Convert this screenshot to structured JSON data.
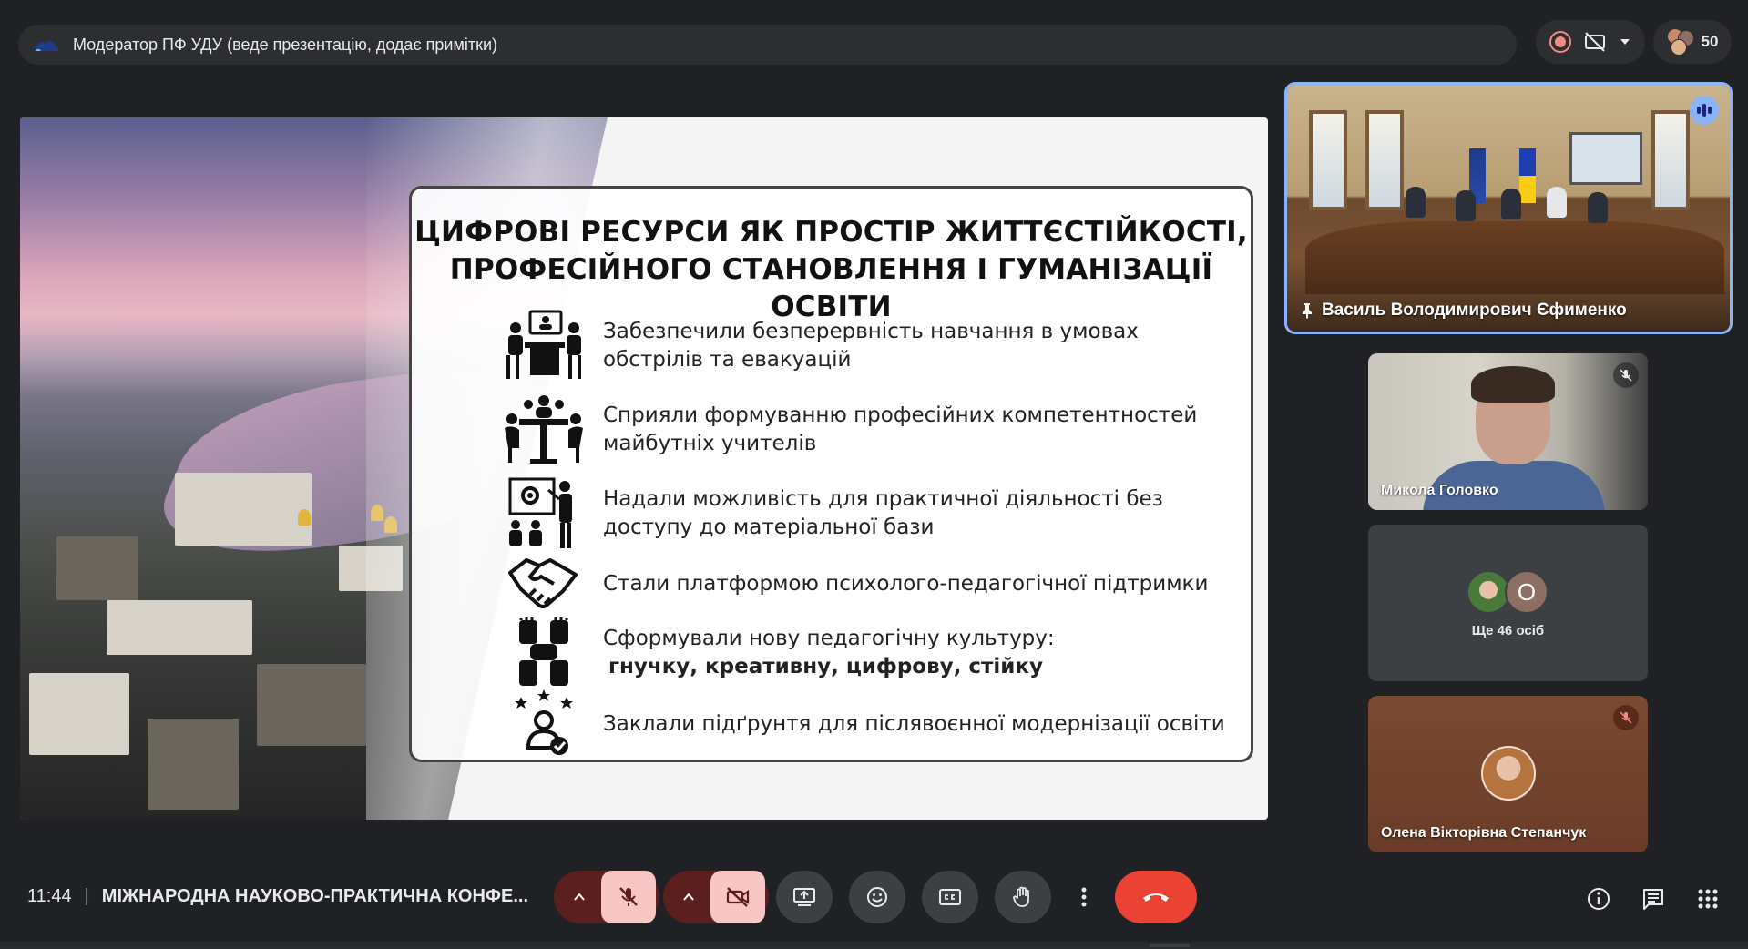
{
  "presenter_bar": {
    "text": "Модератор ПФ УДУ (веде презентацію, додає примітки)"
  },
  "participants": {
    "count": "50"
  },
  "slide": {
    "title_line1": "ЦИФРОВІ РЕСУРСИ ЯК ПРОСТІР ЖИТТЄСТІЙКОСТІ,",
    "title_line2": "ПРОФЕСІЙНОГО СТАНОВЛЕННЯ І ГУМАНІЗАЦІЇ ОСВІТИ",
    "bullets": [
      {
        "line1": "Забезпечили безперервність навчання в умовах",
        "line2": "обстрілів та евакуацій",
        "icon": "online-meeting-icon"
      },
      {
        "line1": "Сприяли формуванню професійних компетентностей",
        "line2": "майбутніх учителів",
        "icon": "team-table-icon"
      },
      {
        "line1": "Надали можливість для практичної діяльності без",
        "line2": "доступу до матеріальної бази",
        "icon": "presentation-teacher-icon"
      },
      {
        "line1": "Стали платформою психолого-педагогічної підтримки",
        "line2": "",
        "icon": "handshake-icon"
      },
      {
        "line1": "Сформували нову педагогічну культуру:",
        "line2_bold": "гнучку, креативну, цифрову, стійку",
        "icon": "hands-together-icon"
      },
      {
        "line1": "Заклали підґрунтя для післявоєнної модернізації освіти",
        "line2": "",
        "icon": "expert-stars-icon"
      }
    ]
  },
  "tiles": {
    "room_name": "Василь Володимирович Єфименко",
    "mykola_name": "Микола Головко",
    "others_letter": "О",
    "others_label": "Ще 46 осіб",
    "olena_name": "Олена Вікторівна Степанчук"
  },
  "bottom": {
    "time": "11:44",
    "separator": "|",
    "meeting_title": "МІЖНАРОДНА НАУКОВО-ПРАКТИЧНА КОНФЕ..."
  },
  "colors": {
    "end_call": "#ea4335",
    "muted_bg": "#f7c6c5",
    "active_outline": "#8ab4f8"
  }
}
